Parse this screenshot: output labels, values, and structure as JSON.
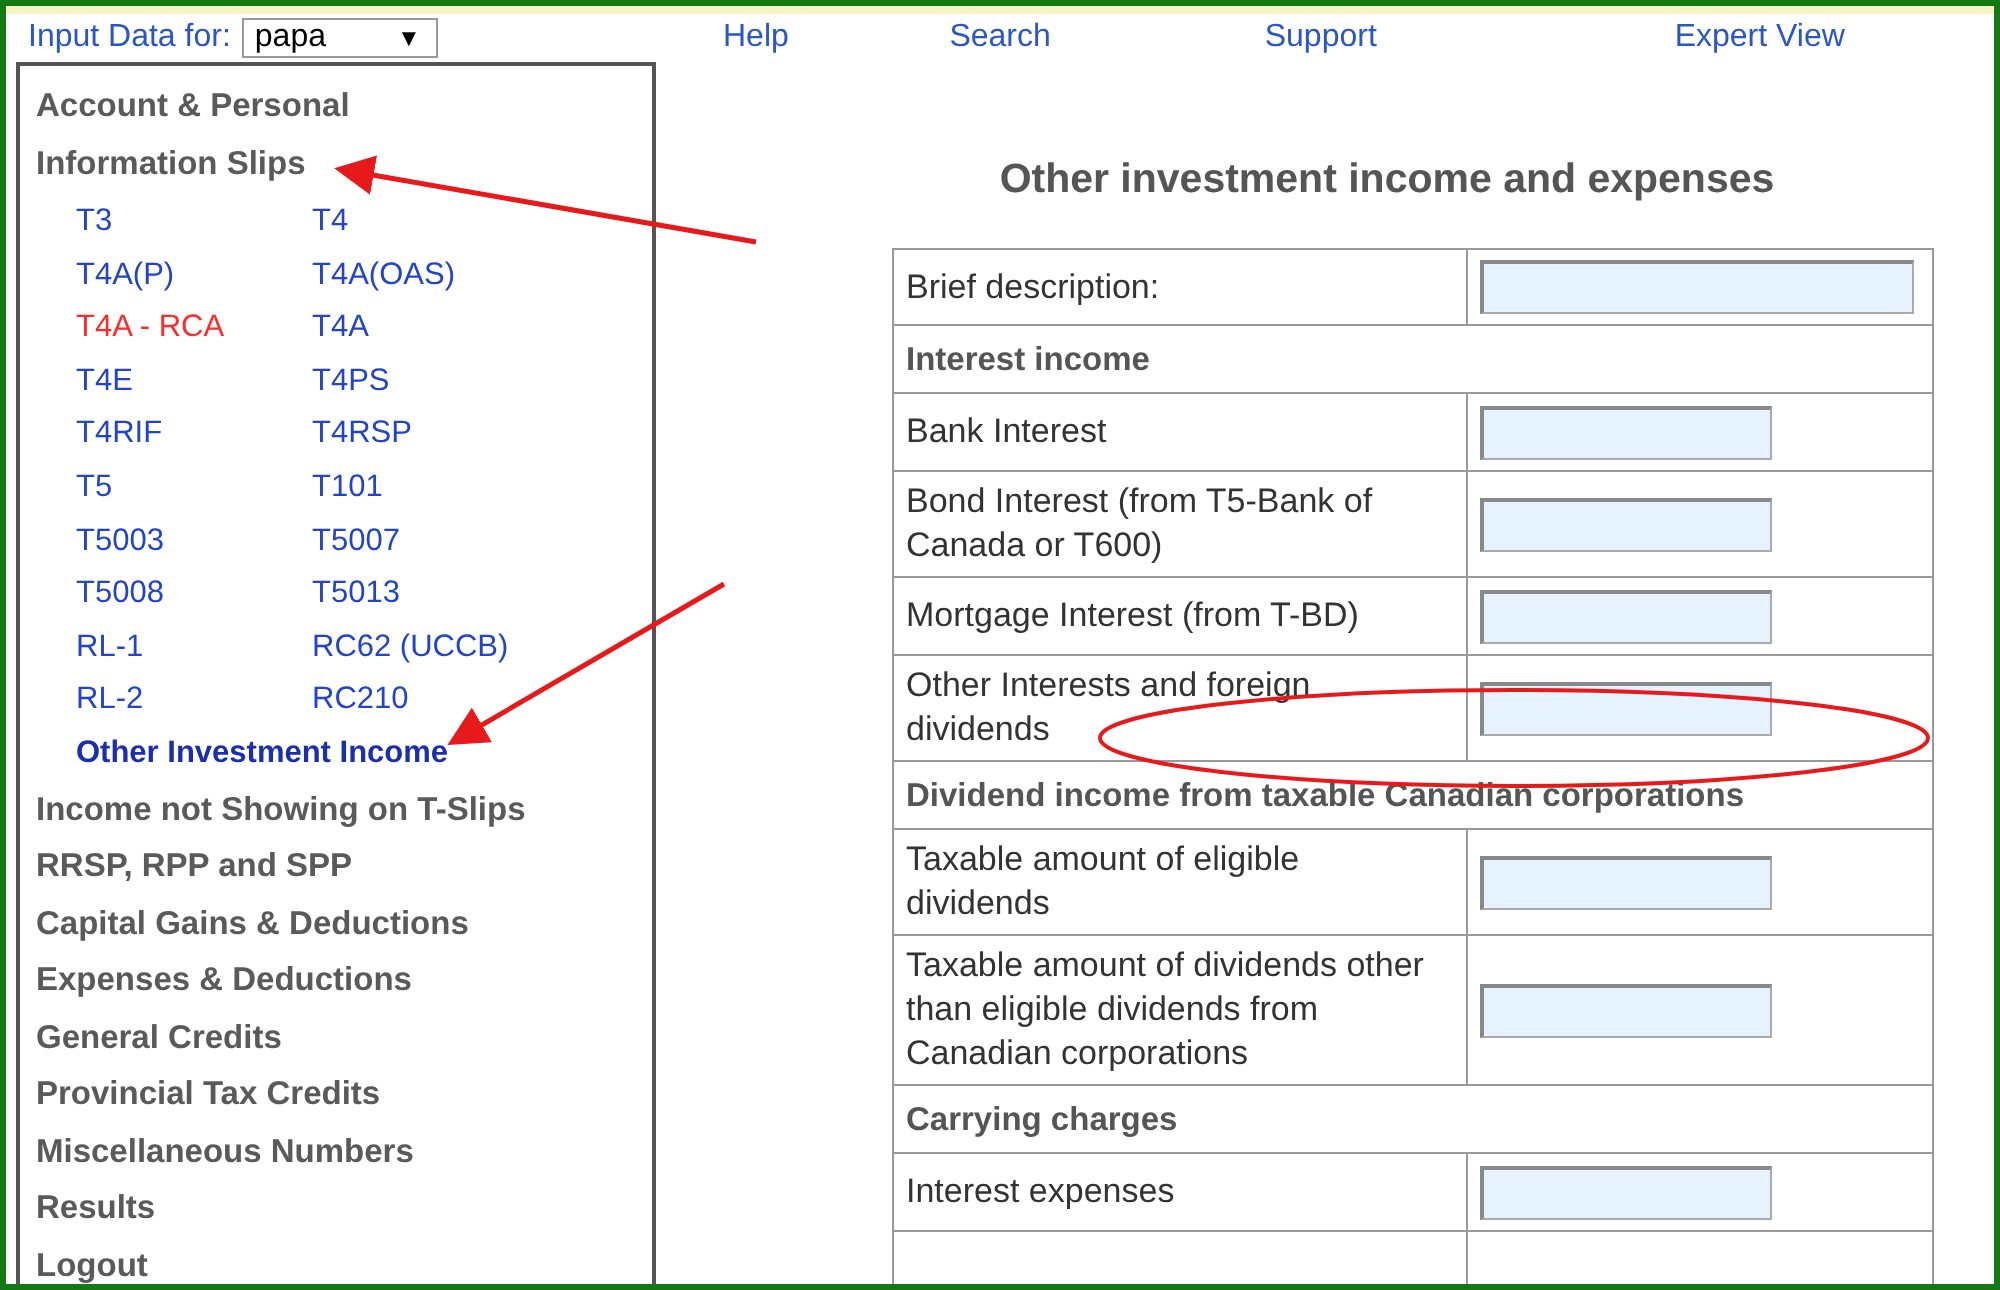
{
  "top_bar": {
    "input_label": "Input Data for:",
    "person_select": {
      "value": "papa",
      "caret": "▼"
    },
    "links": [
      "Help",
      "Search",
      "Support",
      "Expert View"
    ]
  },
  "sidebar": {
    "sections": [
      {
        "label": "Account & Personal"
      },
      {
        "label": "Information Slips",
        "slips": [
          {
            "label": "T3",
            "color": "#2244cc",
            "selected": false
          },
          {
            "label": "T4",
            "color": "#2244cc",
            "selected": false
          },
          {
            "label": "T4A(P)",
            "color": "#2244cc",
            "selected": false
          },
          {
            "label": "T4A(OAS)",
            "color": "#2244cc",
            "selected": false
          },
          {
            "label": "T4A - RCA",
            "color": "#ff2a2a",
            "selected": false
          },
          {
            "label": "T4A",
            "color": "#2244cc",
            "selected": false
          },
          {
            "label": "T4E",
            "color": "#2244cc",
            "selected": false
          },
          {
            "label": "T4PS",
            "color": "#2244cc",
            "selected": false
          },
          {
            "label": "T4RIF",
            "color": "#2244cc",
            "selected": false
          },
          {
            "label": "T4RSP",
            "color": "#2244cc",
            "selected": false
          },
          {
            "label": "T5",
            "color": "#2244cc",
            "selected": false
          },
          {
            "label": "T101",
            "color": "#2244cc",
            "selected": false
          },
          {
            "label": "T5003",
            "color": "#2244cc",
            "selected": false
          },
          {
            "label": "T5007",
            "color": "#2244cc",
            "selected": false
          },
          {
            "label": "T5008",
            "color": "#2244cc",
            "selected": false
          },
          {
            "label": "T5013",
            "color": "#2244cc",
            "selected": false
          },
          {
            "label": "RL-1",
            "color": "#2244cc",
            "selected": false
          },
          {
            "label": "RC62 (UCCB)",
            "color": "#2244cc",
            "selected": false
          },
          {
            "label": "RL-2",
            "color": "#2244cc",
            "selected": false
          },
          {
            "label": "RC210",
            "color": "#2244cc",
            "selected": false
          },
          {
            "label": "Other Investment Income",
            "color": "#1a2fb0",
            "selected": true
          }
        ]
      },
      {
        "label": "Income not Showing on T-Slips"
      },
      {
        "label": "RRSP, RPP and SPP"
      },
      {
        "label": "Capital Gains & Deductions"
      },
      {
        "label": "Expenses & Deductions"
      },
      {
        "label": "General Credits"
      },
      {
        "label": "Provincial Tax Credits"
      },
      {
        "label": "Miscellaneous Numbers"
      },
      {
        "label": "Results"
      },
      {
        "label": "Logout"
      }
    ]
  },
  "form": {
    "title": "Other investment income and expenses",
    "rows": [
      {
        "kind": "text_field",
        "label": "Brief description:"
      },
      {
        "kind": "heading",
        "label": "Interest income"
      },
      {
        "kind": "amount_field",
        "label": "Bank Interest"
      },
      {
        "kind": "amount_field",
        "label": "Bond Interest (from T5-Bank of Canada or T600)"
      },
      {
        "kind": "amount_field",
        "label": "Mortgage Interest (from T-BD)"
      },
      {
        "kind": "amount_field",
        "label": "Other Interests and foreign dividends"
      },
      {
        "kind": "heading",
        "label": "Dividend income from taxable Canadian corporations"
      },
      {
        "kind": "amount_field",
        "label": "Taxable amount of eligible dividends"
      },
      {
        "kind": "amount_field",
        "label": "Taxable amount of dividends other than eligible dividends from Canadian corporations"
      },
      {
        "kind": "heading",
        "label": "Carrying charges"
      },
      {
        "kind": "amount_field",
        "label": "Interest expenses"
      },
      {
        "kind": "blank"
      }
    ]
  }
}
